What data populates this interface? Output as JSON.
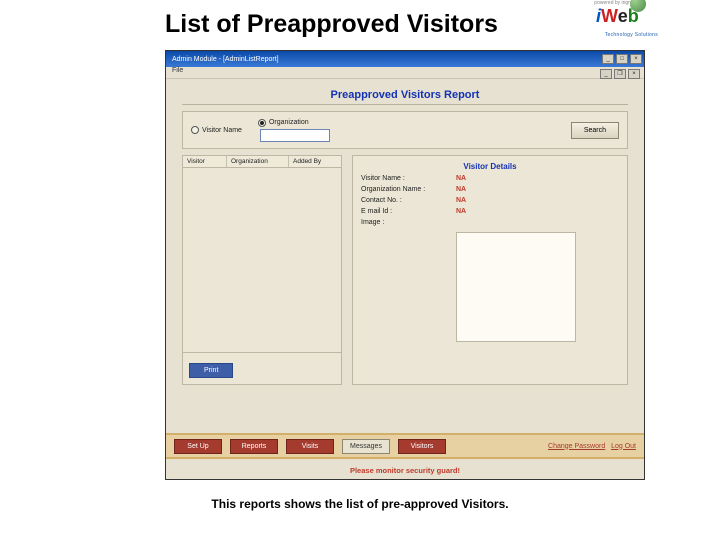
{
  "slide": {
    "title": "List of Preapproved Visitors",
    "caption": "This reports shows the list of pre-approved Visitors."
  },
  "logo": {
    "tagline_top": "powered by ingredients",
    "tagline_bottom": "Technology Solutions"
  },
  "window": {
    "title": "Admin Module - [AdminListReport]"
  },
  "menu": {
    "file": "File"
  },
  "report": {
    "title": "Preapproved Visitors Report"
  },
  "search": {
    "radio_visitor": "Visitor Name",
    "radio_org": "Organization",
    "radio_selected": "org",
    "input_value": "",
    "button": "Search"
  },
  "list": {
    "columns": [
      "Visitor",
      "Organization",
      "Added By"
    ]
  },
  "actions": {
    "print": "Print"
  },
  "details": {
    "title": "Visitor Details",
    "rows": [
      {
        "label": "Visitor Name :",
        "value": "NA"
      },
      {
        "label": "Organization Name :",
        "value": "NA"
      },
      {
        "label": "Contact No. :",
        "value": "NA"
      },
      {
        "label": "E mail Id :",
        "value": "NA"
      },
      {
        "label": "Image :",
        "value": ""
      }
    ]
  },
  "nav": {
    "buttons": [
      "Set Up",
      "Reports",
      "Visits",
      "Messages",
      "Visitors"
    ],
    "change_password": "Change Password",
    "logout": "Log Out"
  },
  "ticker": "Please monitor security guard!"
}
